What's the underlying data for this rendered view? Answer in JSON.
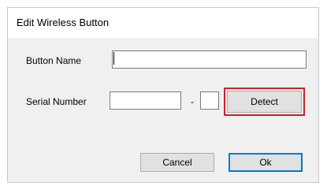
{
  "dialog": {
    "title": "Edit Wireless Button"
  },
  "form": {
    "button_name_label": "Button Name",
    "button_name_value": "",
    "serial_number_label": "Serial Number",
    "serial_part1_value": "",
    "serial_separator": "-",
    "serial_part2_value": "",
    "detect_label": "Detect"
  },
  "footer": {
    "cancel_label": "Cancel",
    "ok_label": "Ok"
  },
  "colors": {
    "highlight": "#c8202a",
    "default_button_accent": "#0078d7"
  }
}
